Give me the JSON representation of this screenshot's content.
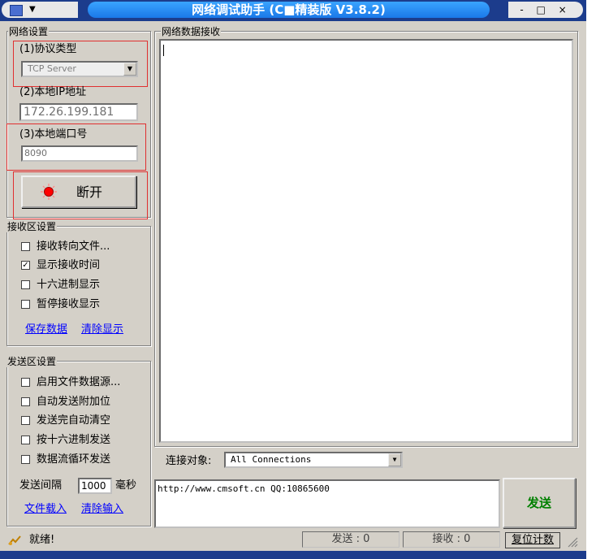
{
  "window": {
    "title": "网络调试助手 (C■精装版 V3.8.2)",
    "controls": "- □ ×"
  },
  "network_settings": {
    "group_label": "网络设置",
    "protocol_label": "(1)协议类型",
    "protocol_value": "TCP Server",
    "local_ip_label": "(2)本地IP地址",
    "local_ip_value": "172.26.199.181",
    "local_port_label": "(3)本地端口号",
    "local_port_value": "8090",
    "connect_button": "断开"
  },
  "receive_settings": {
    "group_label": "接收区设置",
    "options": [
      {
        "label": "接收转向文件...",
        "checked": false
      },
      {
        "label": "显示接收时间",
        "checked": true
      },
      {
        "label": "十六进制显示",
        "checked": false
      },
      {
        "label": "暂停接收显示",
        "checked": false
      }
    ],
    "save_link": "保存数据",
    "clear_link": "清除显示"
  },
  "send_settings": {
    "group_label": "发送区设置",
    "options": [
      {
        "label": "启用文件数据源...",
        "checked": false
      },
      {
        "label": "自动发送附加位",
        "checked": false
      },
      {
        "label": "发送完自动清空",
        "checked": false
      },
      {
        "label": "按十六进制发送",
        "checked": false
      },
      {
        "label": "数据流循环发送",
        "checked": false
      }
    ],
    "interval_label": "发送间隔",
    "interval_value": "1000",
    "interval_unit": "毫秒",
    "load_link": "文件载入",
    "clear_input_link": "清除输入"
  },
  "receive_area": {
    "label": "网络数据接收"
  },
  "connection": {
    "label": "连接对象:",
    "value": "All Connections"
  },
  "send_area": {
    "text": "http://www.cmsoft.cn QQ:10865600",
    "send_button": "发送"
  },
  "status": {
    "text": "就绪!",
    "sent": "发送 : 0",
    "received": "接收 : 0",
    "reset_button": "复位计数"
  },
  "colors": {
    "title_bar": "#1c3c8c",
    "title_pill": "#2a8cf4",
    "send_button_text": "#008000",
    "link": "#0000ff",
    "highlight_box": "#e03030"
  }
}
